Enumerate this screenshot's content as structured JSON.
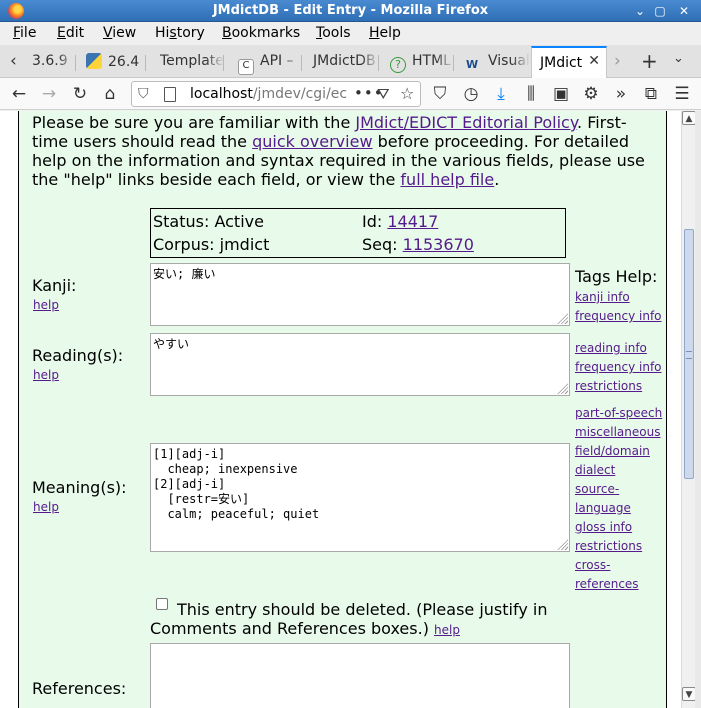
{
  "window": {
    "title": "JMdictDB - Edit Entry - Mozilla Firefox",
    "controls": [
      "⌄",
      "▢",
      "✕"
    ]
  },
  "menu": [
    "File",
    "Edit",
    "View",
    "History",
    "Bookmarks",
    "Tools",
    "Help"
  ],
  "menu_access_keys": [
    "F",
    "E",
    "V",
    "s",
    "B",
    "T",
    "H"
  ],
  "tabs": [
    {
      "label": "3.6.9"
    },
    {
      "label": "26.4"
    },
    {
      "label": "Template"
    },
    {
      "label": "API –"
    },
    {
      "label": "JMdictDB"
    },
    {
      "label": "HTML"
    },
    {
      "label": "Visual"
    },
    {
      "label": "JMdict",
      "active": true
    }
  ],
  "address": {
    "host": "localhost",
    "path": "/jmdev/cgi/ec"
  },
  "intro": {
    "part1": "Please be sure you are familiar with the ",
    "link1": "JMdict/EDICT Editorial Policy",
    "part2": ". First-",
    "line2a": "time users should read the ",
    "link2": "quick overview",
    "line2b": " before proceeding. For detailed",
    "line3": "help on the information and syntax required in the various fields, please use",
    "line4a": "the \"help\" links beside each field, or view the ",
    "link3": "full help file",
    "line4b": "."
  },
  "status": {
    "status_label": "Status: Active",
    "id_label": "Id: ",
    "id_value": "14417",
    "corpus_label": "Corpus: jmdict",
    "seq_label": "Seq: ",
    "seq_value": "1153670"
  },
  "fields": {
    "kanji": {
      "label": "Kanji:",
      "help": "help",
      "value": "安い; 廉い"
    },
    "reading": {
      "label": "Reading(s):",
      "help": "help",
      "value": "やすい"
    },
    "meaning": {
      "label": "Meaning(s):",
      "help": "help",
      "value": "[1][adj-i]\n  cheap; inexpensive\n[2][adj-i]\n  [restr=安い]\n  calm; peaceful; quiet"
    },
    "references": {
      "label": "References:",
      "value": ""
    }
  },
  "tags_help": {
    "title": "Tags Help:",
    "kanji_group": [
      "kanji info",
      "frequency info"
    ],
    "reading_group": [
      "reading info",
      "frequency info",
      "restrictions"
    ],
    "meaning_group": [
      "part-of-speech",
      "miscellaneous",
      "field/domain",
      "dialect",
      "source-",
      "language",
      "gloss info",
      "restrictions",
      "cross-",
      "references"
    ]
  },
  "delete": {
    "line1": "This entry should be deleted. (Please justify in",
    "line2": "Comments and References boxes.) ",
    "help": "help",
    "checked": false
  }
}
